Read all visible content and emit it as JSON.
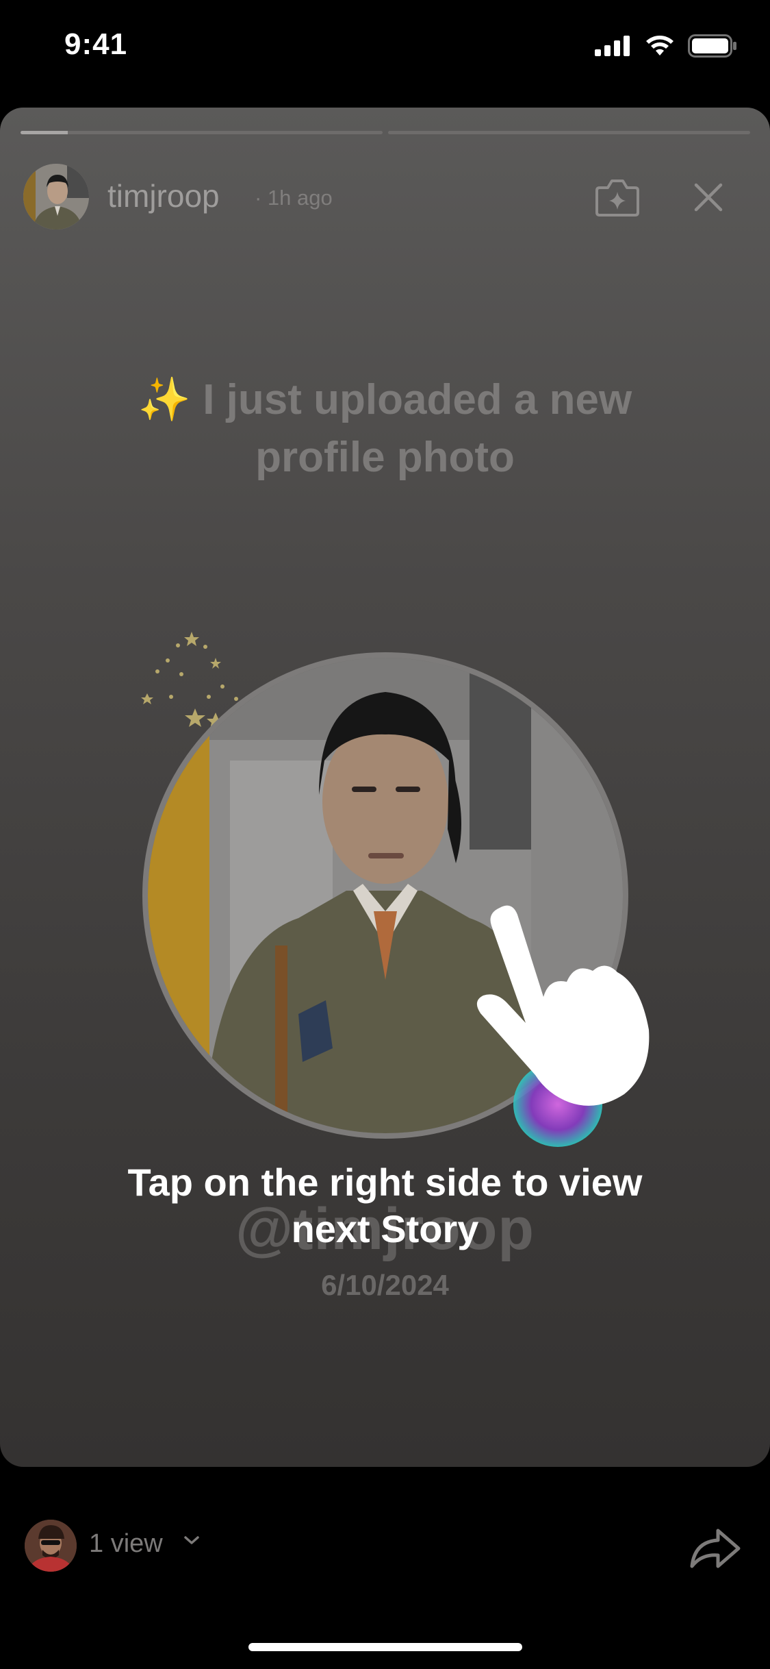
{
  "status_bar": {
    "time": "9:41"
  },
  "story": {
    "username": "timjroop",
    "time_ago": "· 1h ago",
    "progress": [
      0.13,
      0
    ],
    "headline_emoji": "✨",
    "headline": "I just uploaded a new profile photo",
    "handle": "@timjroop",
    "date": "6/10/2024",
    "hint": "Tap on the right side to view next Story"
  },
  "icons": {
    "ai_camera": "sparkle-camera-icon",
    "close": "close-icon",
    "share": "share-arrow-icon",
    "chevron": "chevron-down-icon",
    "hand": "tap-hand-icon"
  },
  "footer": {
    "views": "1 view"
  },
  "colors": {
    "background": "#000000",
    "card": "#4a4847",
    "hint": "#ffffff"
  }
}
